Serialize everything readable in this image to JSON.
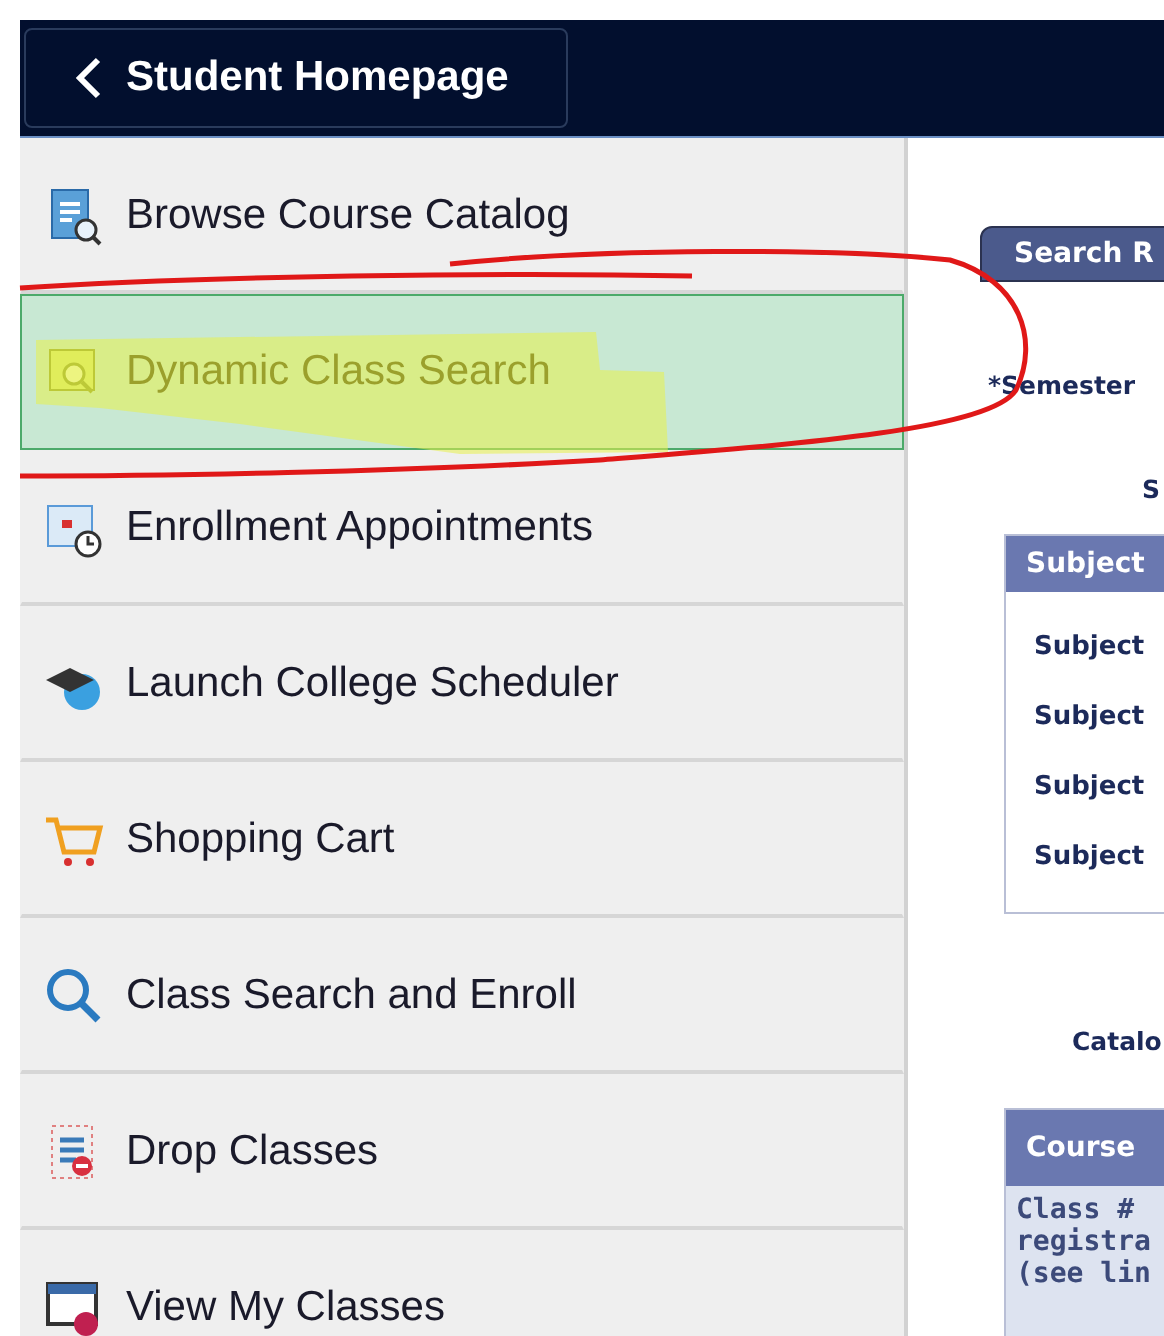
{
  "header": {
    "back_label": "Student Homepage"
  },
  "sidebar": {
    "items": [
      {
        "label": "Browse Course Catalog",
        "selected": false
      },
      {
        "label": "Dynamic Class Search",
        "selected": true
      },
      {
        "label": "Enrollment Appointments",
        "selected": false
      },
      {
        "label": "Launch College Scheduler",
        "selected": false
      },
      {
        "label": "Shopping Cart",
        "selected": false
      },
      {
        "label": "Class Search and Enroll",
        "selected": false
      },
      {
        "label": "Drop Classes",
        "selected": false
      },
      {
        "label": "View My Classes",
        "selected": false
      }
    ]
  },
  "content": {
    "tab_button": "Search R",
    "semester_label": "*Semester",
    "field_label": "S",
    "subject_box": {
      "header": "Subject",
      "rows": [
        "Subject",
        "Subject",
        "Subject",
        "Subject"
      ]
    },
    "catalog_label": "Catalo",
    "course_box": {
      "header": "Course",
      "lines": [
        "Class #",
        "registra",
        "(see lin"
      ]
    }
  }
}
